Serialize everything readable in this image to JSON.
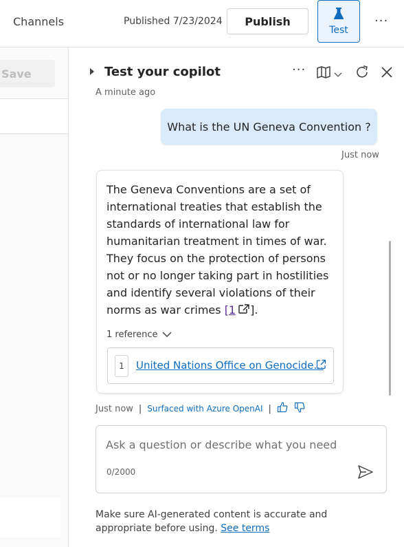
{
  "topbar": {
    "channels_label": "Channels",
    "published_text": "Published 7/23/2024",
    "publish_button": "Publish",
    "test_button": "Test",
    "more_label": "···"
  },
  "left_panel": {
    "save_button": "Save"
  },
  "chat_panel": {
    "title": "Test your copilot",
    "more_label": "···",
    "earlier_timestamp": "A minute ago",
    "user_message": "What is the UN Geneva Convention ?",
    "user_timestamp": "Just now",
    "bot_message": "The Geneva Conventions are a set of international treaties that establish the standards of international law for humanitarian treatment in times of war. They focus on the protection of persons not or no longer taking part in hostilities and identify several violations of their norms as war crimes ",
    "citation_label": "[1",
    "citation_close": "].",
    "reference_toggle": "1 reference",
    "reference": {
      "number": "1",
      "title": "United Nations Office on Genocide..."
    },
    "bot_timestamp": "Just now",
    "meta_separator": "|",
    "azure_label": "Surfaced with Azure OpenAI",
    "input": {
      "placeholder": "Ask a question or describe what you need",
      "value": "",
      "char_count": "0/2000"
    },
    "disclaimer_text": "Make sure AI-generated content is accurate and appropriate before using. ",
    "see_terms": "See terms"
  },
  "colors": {
    "accent": "#0f6cbd",
    "user_bubble": "#d9ebfa",
    "citation": "#5c2e91"
  },
  "icons": [
    "flask-icon",
    "map-icon",
    "chevron-down-icon",
    "refresh-icon",
    "close-icon",
    "external-link-icon",
    "thumbs-up-icon",
    "thumbs-down-icon",
    "send-icon"
  ]
}
